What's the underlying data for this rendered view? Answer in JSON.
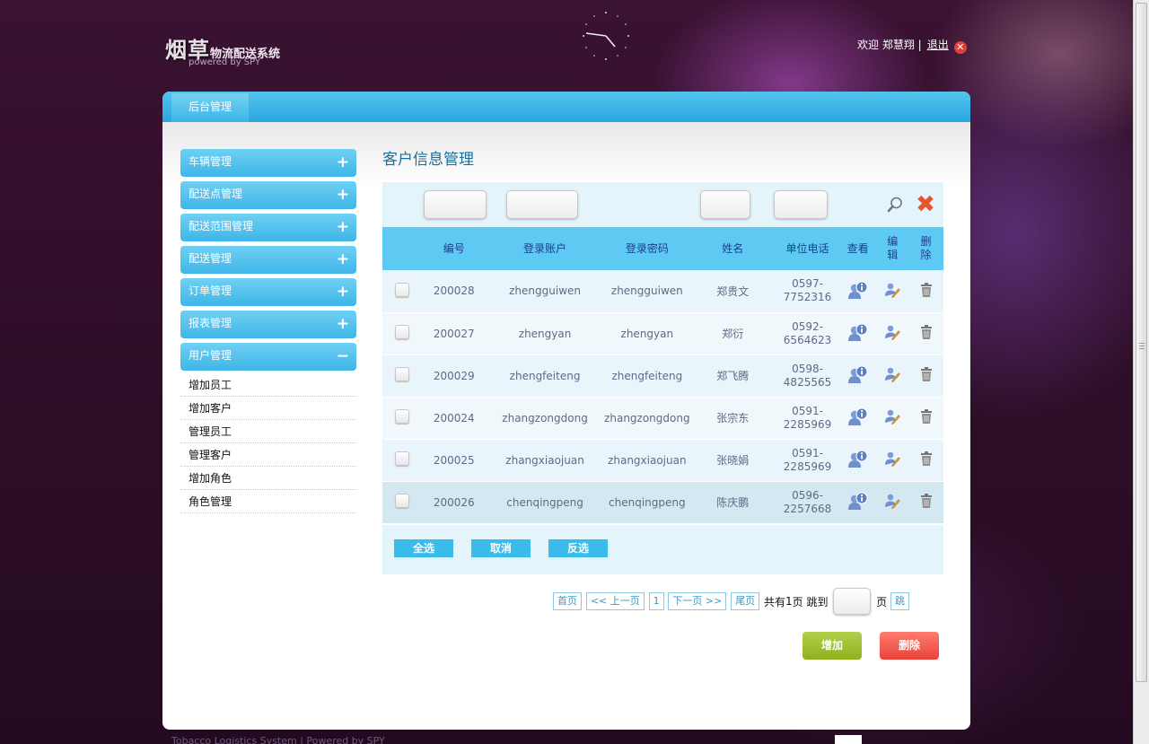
{
  "header": {
    "logo_main": "烟草",
    "logo_sub": "物流配送系统",
    "logo_powered": "powered by SPY",
    "welcome": "欢迎 郑慧翔 |",
    "logout": "退出"
  },
  "topnav": {
    "tab": "后台管理"
  },
  "sidebar": {
    "items": [
      {
        "label": "车辆管理",
        "sign": "+"
      },
      {
        "label": "配送点管理",
        "sign": "+"
      },
      {
        "label": "配送范围管理",
        "sign": "+"
      },
      {
        "label": "配送管理",
        "sign": "+"
      },
      {
        "label": "订单管理",
        "sign": "+"
      },
      {
        "label": "报表管理",
        "sign": "+"
      },
      {
        "label": "用户管理",
        "sign": "−"
      }
    ],
    "subitems": [
      "增加员工",
      "增加客户",
      "管理员工",
      "管理客户",
      "增加角色",
      "角色管理"
    ]
  },
  "content": {
    "title": "客户信息管理",
    "columns": [
      "编号",
      "登录账户",
      "登录密码",
      "姓名",
      "单位电话",
      "查看",
      "编辑",
      "删除"
    ],
    "rows": [
      {
        "id": "200028",
        "account": "zhengguiwen",
        "password": "zhengguiwen",
        "name": "郑贵文",
        "phone1": "0597-",
        "phone2": "7752316"
      },
      {
        "id": "200027",
        "account": "zhengyan",
        "password": "zhengyan",
        "name": "郑衍",
        "phone1": "0592-",
        "phone2": "6564623"
      },
      {
        "id": "200029",
        "account": "zhengfeiteng",
        "password": "zhengfeiteng",
        "name": "郑飞腾",
        "phone1": "0598-",
        "phone2": "4825565"
      },
      {
        "id": "200024",
        "account": "zhangzongdong",
        "password": "zhangzongdong",
        "name": "张宗东",
        "phone1": "0591-",
        "phone2": "2285969"
      },
      {
        "id": "200025",
        "account": "zhangxiaojuan",
        "password": "zhangxiaojuan",
        "name": "张晓娟",
        "phone1": "0591-",
        "phone2": "2285969"
      },
      {
        "id": "200026",
        "account": "chenqingpeng",
        "password": "chenqingpeng",
        "name": "陈庆鹏",
        "phone1": "0596-",
        "phone2": "2257668"
      }
    ],
    "actions": {
      "select_all": "全选",
      "cancel": "取消",
      "invert": "反选"
    },
    "pager": {
      "first": "首页",
      "prev": "<< 上一页",
      "page": "1",
      "next": "下一页 >>",
      "last": "尾页",
      "total_pre": "共有",
      "total_num": "1",
      "total_post": "页 跳到",
      "page_unit": "页",
      "go": "跳"
    },
    "buttons": {
      "add": "增加",
      "delete": "删除"
    }
  },
  "footer": {
    "text": "Tobacco Logistics System | Powered by SPY"
  },
  "colors": {
    "accent": "#3fb6e8",
    "header_bg": "#2e0e28",
    "add": "#9cbd2e",
    "delete": "#f05a4f"
  }
}
